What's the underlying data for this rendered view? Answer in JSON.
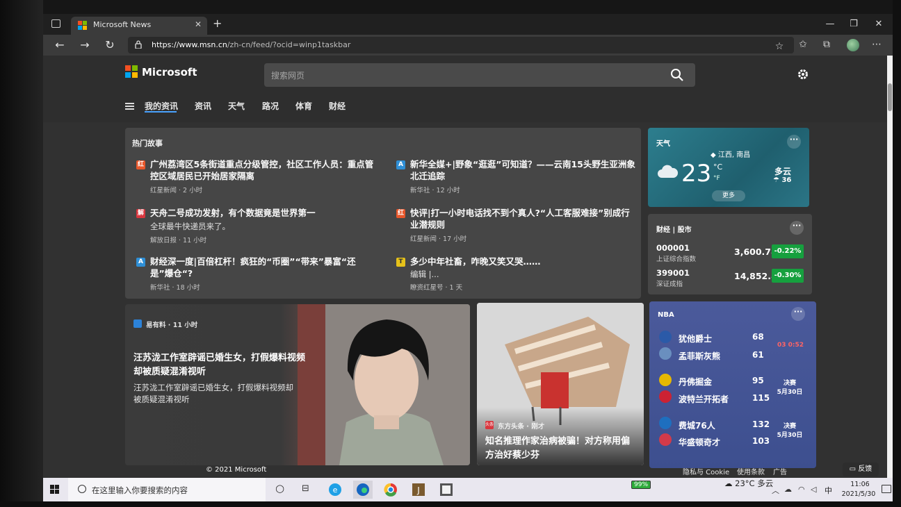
{
  "browser": {
    "tab_title": "Microsoft News",
    "new_tab_icon": "plus-icon",
    "url_host": "https://www.msn.cn",
    "url_path": "/zh-cn/feed/?ocid=winp1taskbar"
  },
  "header": {
    "brand": "Microsoft",
    "search_placeholder": "搜索网页"
  },
  "nav": {
    "items": [
      "我的资讯",
      "资讯",
      "天气",
      "路况",
      "体育",
      "财经"
    ]
  },
  "hot_stories": {
    "title": "热门故事",
    "items": [
      {
        "headline": "广州荔湾区5条街道重点分级管控，社区工作人员：重点管控区域居民已开始居家隔离",
        "sub": "",
        "meta": "红星新闻 · 2 小时"
      },
      {
        "headline": "新华全媒+|野象“逛逛”可知道？——云南15头野生亚洲象北迁追踪",
        "sub": "",
        "meta": "新华社 · 12 小时"
      },
      {
        "headline": "天舟二号成功发射，有个数据竟是世界第一",
        "sub": "全球最牛快递员来了。",
        "meta": "解放日报 · 11 小时"
      },
      {
        "headline": "快评|打一小时电话找不到个真人?“人工客服难接”别成行业潜规则",
        "sub": "",
        "meta": "红星新闻 · 17 小时"
      },
      {
        "headline": "财经深一度|百倍杠杆！疯狂的“币圈”“带来”暴富“还是”爆仓“?",
        "sub": "",
        "meta": "新华社 · 18 小时"
      },
      {
        "headline": "多少中年社畜，咋晚又笑又哭……",
        "sub": "编辑 |...",
        "meta": "瞭资红星号 · 1 天"
      }
    ]
  },
  "weather": {
    "label": "天气",
    "location": "江西, 南昌",
    "temp": "23",
    "unit_c": "°C",
    "unit_f": "°F",
    "condition": "多云",
    "feel": "36",
    "more": "更多"
  },
  "finance": {
    "label": "财经 | 股市",
    "stocks": [
      {
        "code": "000001",
        "name": "上证综合指数",
        "value": "3,600.78",
        "change": "-0.22%"
      },
      {
        "code": "399001",
        "name": "深证成指",
        "value": "14,852.88",
        "change": "-0.30%"
      }
    ],
    "change_color": "#16a03e"
  },
  "article1": {
    "source": "易有料 · 11 小时",
    "headline": "汪苏泷工作室辟谣已婚生女，打假爆料视频却被质疑混淆视听",
    "summary": "汪苏泷工作室辟谣已婚生女，打假爆料视频却被质疑混淆视听"
  },
  "article2": {
    "source": "东方头条 · 刚才",
    "source_icon_text": "头条",
    "headline": "知名推理作家治病被骗！对方称用偏方治好蔡少芬"
  },
  "nba": {
    "label": "NBA",
    "live": "03 0:52",
    "games": [
      {
        "teams": [
          {
            "name": "犹他爵士",
            "score": "68",
            "color": "#2b5aa8"
          },
          {
            "name": "孟菲斯灰熊",
            "score": "61",
            "color": "#6a8fbf"
          }
        ],
        "tag": ""
      },
      {
        "teams": [
          {
            "name": "丹佛掘金",
            "score": "95",
            "color": "#e6b800"
          },
          {
            "name": "波特兰开拓者",
            "score": "115",
            "color": "#cc2233"
          }
        ],
        "tag": "决赛\n5月30日"
      },
      {
        "teams": [
          {
            "name": "费城76人",
            "score": "132",
            "color": "#1e6fbf"
          },
          {
            "name": "华盛顿奇才",
            "score": "103",
            "color": "#d23a4a"
          }
        ],
        "tag": "决赛\n5月30日"
      }
    ]
  },
  "footer": {
    "copyright": "© 2021 Microsoft",
    "privacy": "隐私与 Cookie",
    "terms": "使用条款",
    "ads": "广告",
    "feedback": "反馈"
  },
  "taskbar": {
    "search_placeholder": "在这里输入你要搜索的内容",
    "battery": "99%",
    "weather": "23°C 多云",
    "lang": "中",
    "time": "11:06",
    "date": "2021/5/30"
  }
}
